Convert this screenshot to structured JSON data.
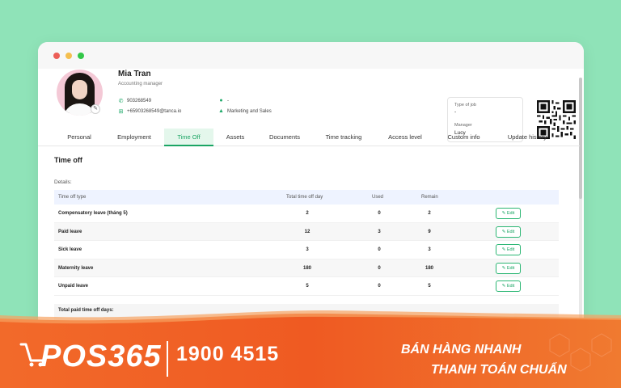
{
  "profile": {
    "name": "Mia Tran",
    "role": "Accounting manager",
    "phone": "903268549",
    "email": "+65903268549@tanca.io",
    "dash": "-",
    "department": "Marketing and Sales",
    "type_of_job_label": "Type of job",
    "type_of_job_value": "-",
    "manager_label": "Manager",
    "manager_value": "Lucy"
  },
  "tabs": [
    {
      "label": "Personal"
    },
    {
      "label": "Employment"
    },
    {
      "label": "Time Off",
      "active": true
    },
    {
      "label": "Assets"
    },
    {
      "label": "Documents"
    },
    {
      "label": "Time tracking"
    },
    {
      "label": "Access level"
    },
    {
      "label": "Custom info"
    },
    {
      "label": "Update history"
    }
  ],
  "section": {
    "title": "Time off",
    "details_label": "Details:"
  },
  "table": {
    "headers": {
      "type": "Time off type",
      "total": "Total time off day",
      "used": "Used",
      "remain": "Remain"
    },
    "edit_label": "Edit",
    "rows": [
      {
        "type": "Compensatory leave (tháng 5)",
        "total": "2",
        "used": "0",
        "remain": "2"
      },
      {
        "type": "Paid leave",
        "total": "12",
        "used": "3",
        "remain": "9"
      },
      {
        "type": "Sick leave",
        "total": "3",
        "used": "0",
        "remain": "3"
      },
      {
        "type": "Maternity leave",
        "total": "180",
        "used": "0",
        "remain": "180"
      },
      {
        "type": "Unpaid leave",
        "total": "5",
        "used": "0",
        "remain": "5"
      }
    ],
    "total_label": "Total paid time off days:"
  },
  "banner": {
    "logo": "POS365",
    "phone": "1900 4515",
    "slogan_line1": "BÁN HÀNG NHANH",
    "slogan_line2": "THANH TOÁN CHUẨN"
  },
  "colors": {
    "background": "#8fe3b8",
    "accent": "#1aa564",
    "banner_orange": "#f05a24"
  }
}
